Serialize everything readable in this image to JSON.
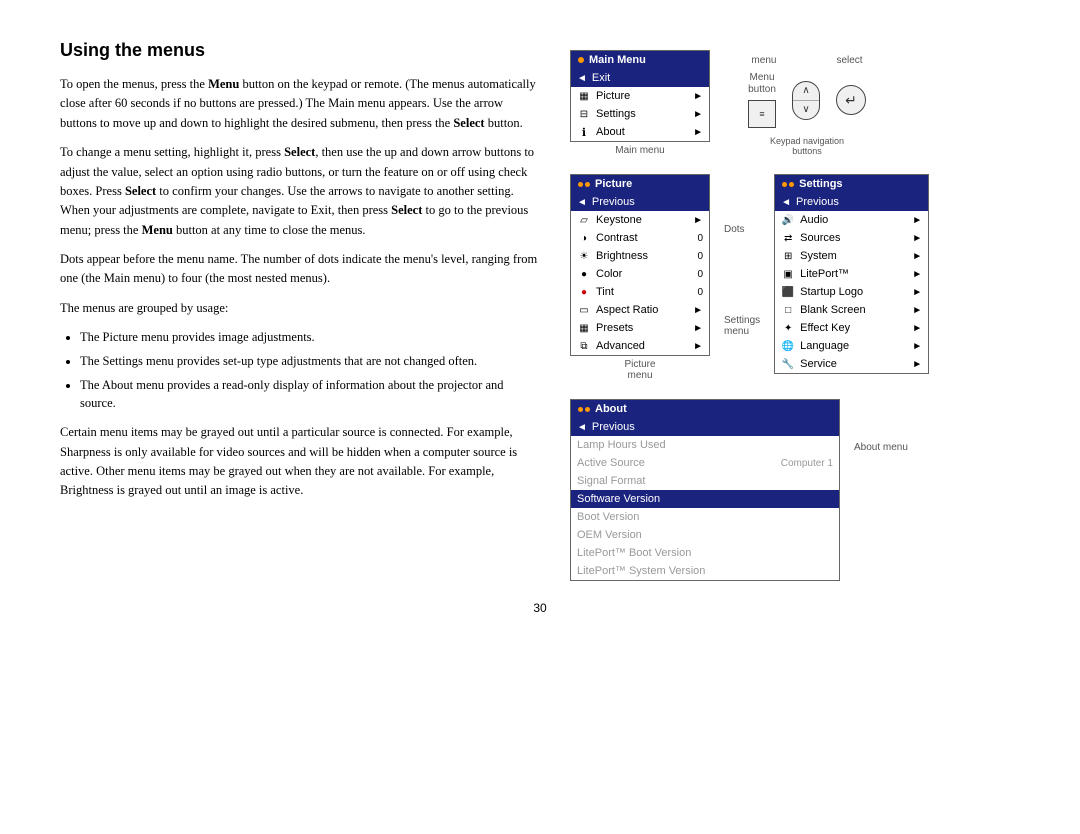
{
  "page": {
    "title": "Using the menus",
    "page_number": "30"
  },
  "body_text": {
    "para1": "To open the menus, press the Menu button on the keypad or remote. (The menus automatically close after 60 seconds if no buttons are pressed.) The Main menu appears. Use the arrow buttons to move up and down to highlight the desired submenu, then press the Select button.",
    "para2": "To change a menu setting, highlight it, press Select, then use the up and down arrow buttons to adjust the value, select an option using radio buttons, or turn the feature on or off using check boxes. Press Select to confirm your changes. Use the arrows to navigate to another setting. When your adjustments are complete, navigate to Exit, then press Select to go to the previous menu; press the Menu button at any time to close the menus.",
    "para3": "Dots appear before the menu name. The number of dots indicate the menu's level, ranging from one (the Main menu) to four (the most nested menus).",
    "para4": "The menus are grouped by usage:",
    "bullet1": "The Picture menu provides image adjustments.",
    "bullet2": "The Settings menu provides set-up type adjustments that are not changed often.",
    "bullet3": "The About menu provides a read-only display of information about the projector and source.",
    "para5": "Certain menu items may be grayed out until a particular source is connected. For example, Sharpness is only available for video sources and will be hidden when a computer source is active. Other menu items may be grayed out when they are not available. For example, Brightness is grayed out until an image is active."
  },
  "main_menu": {
    "title": "Main Menu",
    "items": [
      {
        "label": "Exit",
        "selected": true,
        "icon": "arrow-left",
        "has_arrow": false
      },
      {
        "label": "Picture",
        "icon": "picture",
        "has_arrow": true
      },
      {
        "label": "Settings",
        "icon": "settings",
        "has_arrow": true
      },
      {
        "label": "About",
        "icon": "info",
        "has_arrow": true
      }
    ],
    "caption": "Main menu"
  },
  "picture_menu": {
    "title": "Picture",
    "dots": 2,
    "items": [
      {
        "label": "Previous",
        "selected": true,
        "icon": "arrow-left",
        "has_arrow": false,
        "value": ""
      },
      {
        "label": "Keystone",
        "icon": "",
        "has_arrow": true,
        "value": ""
      },
      {
        "label": "Contrast",
        "icon": "contrast",
        "has_arrow": false,
        "value": "0"
      },
      {
        "label": "Brightness",
        "icon": "brightness",
        "has_arrow": false,
        "value": "0"
      },
      {
        "label": "Color",
        "icon": "color",
        "has_arrow": false,
        "value": "0"
      },
      {
        "label": "Tint",
        "icon": "tint",
        "has_arrow": false,
        "value": "0"
      },
      {
        "label": "Aspect Ratio",
        "icon": "",
        "has_arrow": true,
        "value": ""
      },
      {
        "label": "Presets",
        "icon": "presets",
        "has_arrow": true,
        "value": ""
      },
      {
        "label": "Advanced",
        "icon": "advanced",
        "has_arrow": true,
        "value": ""
      }
    ],
    "caption": "Picture\nmenu"
  },
  "settings_menu": {
    "title": "Settings",
    "dots": 2,
    "items": [
      {
        "label": "Previous",
        "selected": true,
        "icon": "arrow-left",
        "has_arrow": false
      },
      {
        "label": "Audio",
        "icon": "audio",
        "has_arrow": true
      },
      {
        "label": "Sources",
        "icon": "sources",
        "has_arrow": true
      },
      {
        "label": "System",
        "icon": "system",
        "has_arrow": true
      },
      {
        "label": "LitePort™",
        "icon": "liteport",
        "has_arrow": true
      },
      {
        "label": "Startup Logo",
        "icon": "startup",
        "has_arrow": true
      },
      {
        "label": "Blank Screen",
        "icon": "",
        "has_arrow": true
      },
      {
        "label": "Effect Key",
        "icon": "effect",
        "has_arrow": true
      },
      {
        "label": "Language",
        "icon": "language",
        "has_arrow": true
      },
      {
        "label": "Service",
        "icon": "service",
        "has_arrow": true
      }
    ]
  },
  "about_menu": {
    "title": "About",
    "dots": 2,
    "items": [
      {
        "label": "Previous",
        "selected": true,
        "icon": "arrow-left",
        "grayed": false
      },
      {
        "label": "Lamp Hours Used",
        "value": "",
        "grayed": true
      },
      {
        "label": "Active Source",
        "value": "Computer 1",
        "grayed": true
      },
      {
        "label": "Signal Format",
        "value": "",
        "grayed": true
      },
      {
        "label": "Software Version",
        "value": "",
        "highlighted": true,
        "grayed": false
      },
      {
        "label": "Boot Version",
        "value": "",
        "grayed": true
      },
      {
        "label": "OEM Version",
        "value": "",
        "grayed": true
      },
      {
        "label": "LitePort™ Boot Version",
        "value": "",
        "grayed": true
      },
      {
        "label": "LitePort™ System Version",
        "value": "",
        "grayed": true
      }
    ],
    "caption": "About menu"
  },
  "nav_controls": {
    "menu_label": "Menu\nbutton",
    "menu_icon": "≡",
    "select_label": "select",
    "select_icon": "↵",
    "up_icon": "∧",
    "down_icon": "∨",
    "keypad_caption": "Keypad navigation\nbuttons"
  },
  "labels": {
    "dots": "Dots",
    "settings_menu": "Settings\nmenu"
  }
}
